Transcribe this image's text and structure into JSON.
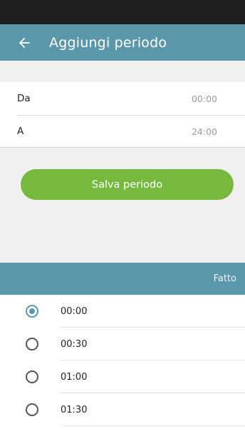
{
  "header": {
    "title": "Aggiungi periodo",
    "back_icon": "arrow-left-icon",
    "color": "#5b97aa"
  },
  "form": {
    "from_label": "Da",
    "from_value": "00:00",
    "to_label": "A",
    "to_value": "24:00"
  },
  "save_button": {
    "label": "Salva periodo",
    "color": "#77b83f"
  },
  "picker": {
    "done_label": "Fatto",
    "selected": "00:00",
    "options": [
      "00:00",
      "00:30",
      "01:00",
      "01:30"
    ]
  }
}
